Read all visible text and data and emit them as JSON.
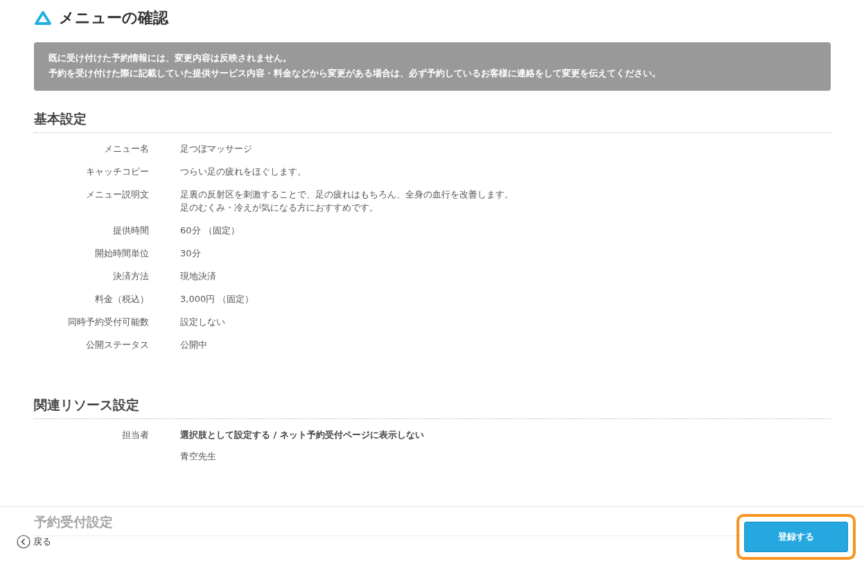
{
  "page_title": "メニューの確認",
  "notice": [
    "既に受け付けた予約情報には、変更内容は反映されません。",
    "予約を受け付けた際に記載していた提供サービス内容・料金などから変更がある場合は、必ず予約しているお客様に連絡をして変更を伝えてください。"
  ],
  "sections": [
    {
      "heading": "基本設定",
      "rows": [
        {
          "label": "メニュー名",
          "values": [
            {
              "text": "足つぼマッサージ",
              "bold": false
            }
          ]
        },
        {
          "label": "キャッチコピー",
          "values": [
            {
              "text": "つらい足の疲れをほぐします。",
              "bold": false
            }
          ]
        },
        {
          "label": "メニュー説明文",
          "values": [
            {
              "text": "足裏の反射区を刺激することで、足の疲れはもちろん、全身の血行を改善します。",
              "bold": false
            },
            {
              "text": "足のむくみ・冷えが気になる方におすすめです。",
              "bold": false
            }
          ]
        },
        {
          "label": "提供時間",
          "values": [
            {
              "text": "60分 （固定）",
              "bold": false
            }
          ]
        },
        {
          "label": "開始時間単位",
          "values": [
            {
              "text": "30分",
              "bold": false
            }
          ]
        },
        {
          "label": "決済方法",
          "values": [
            {
              "text": "現地決済",
              "bold": false
            }
          ]
        },
        {
          "label": "料金（税込）",
          "values": [
            {
              "text": "3,000円 （固定）",
              "bold": false
            }
          ]
        },
        {
          "label": "同時予約受付可能数",
          "values": [
            {
              "text": "設定しない",
              "bold": false
            }
          ]
        },
        {
          "label": "公開ステータス",
          "values": [
            {
              "text": "公開中",
              "bold": false
            }
          ]
        }
      ]
    },
    {
      "heading": "関連リソース設定",
      "rows": [
        {
          "label": "担当者",
          "values": [
            {
              "text": "選択肢として設定する / ネット予約受付ページに表示しない",
              "bold": true
            },
            {
              "text": "青空先生",
              "bold": false
            }
          ]
        }
      ]
    },
    {
      "heading": "予約受付設定"
    }
  ],
  "footer": {
    "back_button": "戻る",
    "submit_button": "登録する"
  }
}
